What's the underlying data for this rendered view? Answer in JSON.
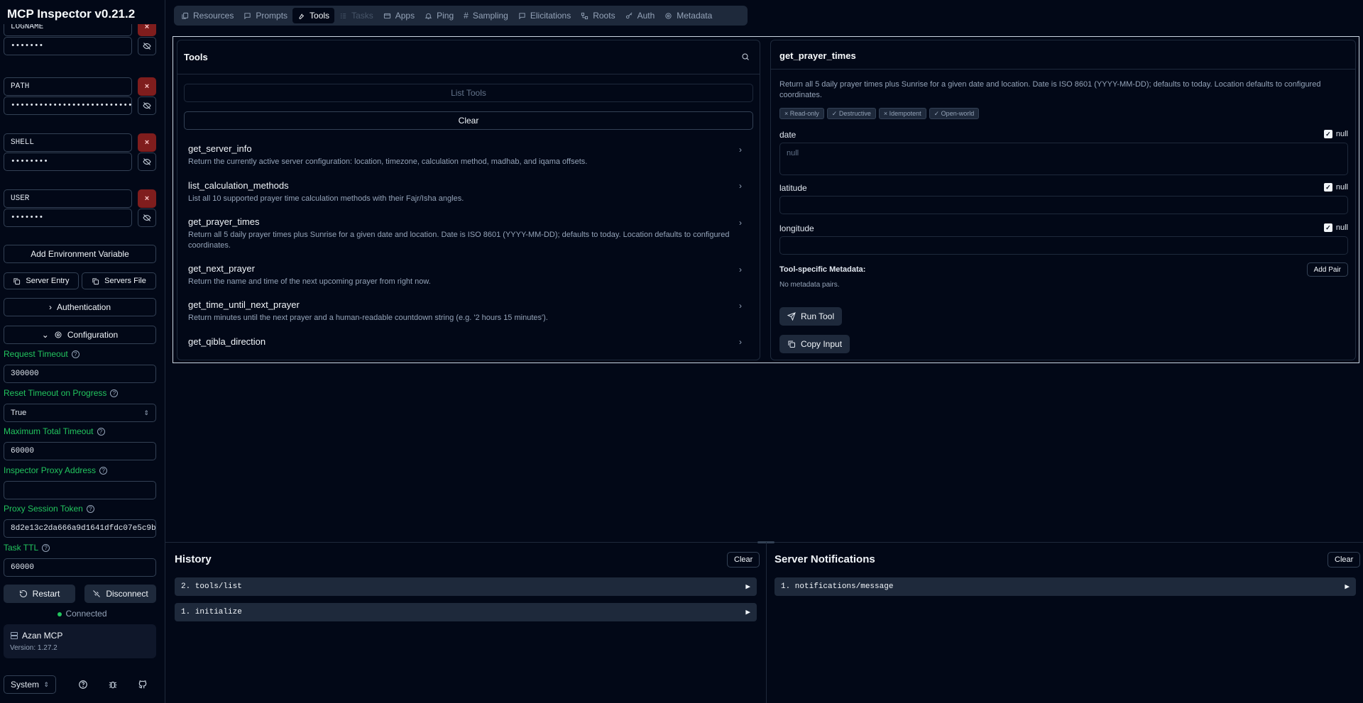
{
  "app": {
    "title": "MCP Inspector v0.21.2"
  },
  "sidebar": {
    "env": [
      {
        "key": "LOGNAME",
        "value": "•••••••"
      },
      {
        "key": "PATH",
        "value": "•••••••••••••••••••••••••••"
      },
      {
        "key": "SHELL",
        "value": "••••••••"
      },
      {
        "key": "USER",
        "value": "•••••••"
      }
    ],
    "add_env_label": "Add Environment Variable",
    "server_entry_label": "Server Entry",
    "servers_file_label": "Servers File",
    "auth_label": "Authentication",
    "config_label": "Configuration",
    "request_timeout_label": "Request Timeout",
    "request_timeout_value": "300000",
    "reset_timeout_label": "Reset Timeout on Progress",
    "reset_timeout_value": "True",
    "max_timeout_label": "Maximum Total Timeout",
    "max_timeout_value": "60000",
    "proxy_address_label": "Inspector Proxy Address",
    "proxy_address_value": "",
    "proxy_token_label": "Proxy Session Token",
    "proxy_token_value": "8d2e13c2da666a9d1641dfdc07e5c9b",
    "task_ttl_label": "Task TTL",
    "task_ttl_value": "60000",
    "restart_label": "Restart",
    "disconnect_label": "Disconnect",
    "status": "Connected",
    "server_name": "Azan MCP",
    "server_version": "Version: 1.27.2",
    "theme_value": "System"
  },
  "tabs": [
    {
      "label": "Resources",
      "icon": "resources-icon"
    },
    {
      "label": "Prompts",
      "icon": "prompts-icon"
    },
    {
      "label": "Tools",
      "icon": "tools-icon"
    },
    {
      "label": "Tasks",
      "icon": "tasks-icon"
    },
    {
      "label": "Apps",
      "icon": "apps-icon"
    },
    {
      "label": "Ping",
      "icon": "bell-icon"
    },
    {
      "label": "Sampling",
      "icon": "hash-icon"
    },
    {
      "label": "Elicitations",
      "icon": "message-icon"
    },
    {
      "label": "Roots",
      "icon": "roots-icon"
    },
    {
      "label": "Auth",
      "icon": "key-icon"
    },
    {
      "label": "Metadata",
      "icon": "gear-icon"
    }
  ],
  "tools_panel": {
    "title": "Tools",
    "list_tools_label": "List Tools",
    "clear_label": "Clear",
    "items": [
      {
        "name": "get_server_info",
        "desc": "Return the currently active server configuration: location, timezone, calculation method, madhab, and iqama offsets."
      },
      {
        "name": "list_calculation_methods",
        "desc": "List all 10 supported prayer time calculation methods with their Fajr/Isha angles."
      },
      {
        "name": "get_prayer_times",
        "desc": "Return all 5 daily prayer times plus Sunrise for a given date and location. Date is ISO 8601 (YYYY-MM-DD); defaults to today. Location defaults to configured coordinates."
      },
      {
        "name": "get_next_prayer",
        "desc": "Return the name and time of the next upcoming prayer from right now."
      },
      {
        "name": "get_time_until_next_prayer",
        "desc": "Return minutes until the next prayer and a human-readable countdown string (e.g. '2 hours 15 minutes')."
      },
      {
        "name": "get_qibla_direction",
        "desc": ""
      }
    ]
  },
  "detail": {
    "title": "get_prayer_times",
    "desc": "Return all 5 daily prayer times plus Sunrise for a given date and location. Date is ISO 8601 (YYYY-MM-DD); defaults to today. Location defaults to configured coordinates.",
    "chips": [
      "× Read-only",
      "✓ Destructive",
      "× Idempotent",
      "✓ Open-world"
    ],
    "params": [
      {
        "name": "date",
        "null_label": "null",
        "placeholder": "null"
      },
      {
        "name": "latitude",
        "null_label": "null",
        "placeholder": ""
      },
      {
        "name": "longitude",
        "null_label": "null",
        "placeholder": ""
      }
    ],
    "metadata_label": "Tool-specific Metadata:",
    "add_pair_label": "Add Pair",
    "no_metadata": "No metadata pairs.",
    "run_label": "Run Tool",
    "copy_label": "Copy Input"
  },
  "history": {
    "title": "History",
    "clear_label": "Clear",
    "items": [
      "2. tools/list",
      "1. initialize"
    ]
  },
  "notifications": {
    "title": "Server Notifications",
    "clear_label": "Clear",
    "items": [
      "1. notifications/message"
    ]
  }
}
